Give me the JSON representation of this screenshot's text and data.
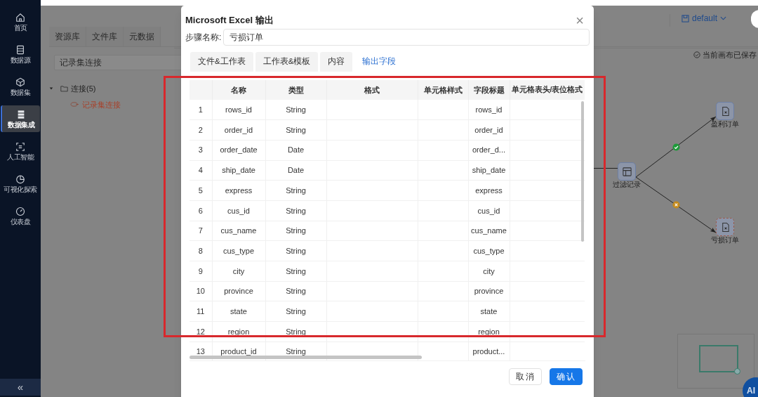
{
  "sidebar": {
    "items": [
      {
        "label": "首页",
        "selected": false
      },
      {
        "label": "数据源",
        "selected": false
      },
      {
        "label": "数据集",
        "selected": false
      },
      {
        "label": "数据集成",
        "selected": true
      },
      {
        "label": "人工智能",
        "selected": false
      },
      {
        "label": "可视化探索",
        "selected": false
      },
      {
        "label": "仪表盘",
        "selected": false
      }
    ],
    "collapse": "«"
  },
  "left_panel": {
    "tabs": [
      {
        "label": "资源库"
      },
      {
        "label": "文件库"
      },
      {
        "label": "元数据"
      }
    ],
    "search": {
      "value": "记录集连接"
    },
    "tree": [
      {
        "label": "连接(5)",
        "expanded": true,
        "children": [
          {
            "label": "记录集连接",
            "highlighted": true
          }
        ]
      }
    ]
  },
  "top_bar": {
    "workspace": "default",
    "save_status": "当前画布已保存"
  },
  "canvas": {
    "nodes": [
      {
        "label": "过滤记录",
        "kind": "filter",
        "selected": false
      },
      {
        "label": "盈利订单",
        "kind": "excel",
        "selected": false
      },
      {
        "label": "亏损订单",
        "kind": "excel",
        "selected": true
      }
    ],
    "edges": [
      {
        "kind": "success"
      },
      {
        "kind": "failure"
      }
    ],
    "ai_button": "AI"
  },
  "dialog": {
    "title": "Microsoft Excel 输出",
    "close": "×",
    "step_name": {
      "label": "步骤名称:",
      "value": "亏损订单"
    },
    "tabs": [
      {
        "label": "文件&工作表",
        "selected": false
      },
      {
        "label": "工作表&模板",
        "selected": false
      },
      {
        "label": "内容",
        "selected": false
      },
      {
        "label": "输出字段",
        "selected": true
      }
    ],
    "table": {
      "columns": [
        "名称",
        "类型",
        "格式",
        "单元格样式",
        "字段标题",
        "单元格表头/表位格式"
      ],
      "rows": [
        {
          "index": "1",
          "name": "rows_id",
          "type": "String",
          "title": "rows_id"
        },
        {
          "index": "2",
          "name": "order_id",
          "type": "String",
          "title": "order_id"
        },
        {
          "index": "3",
          "name": "order_date",
          "type": "Date",
          "title": "order_d..."
        },
        {
          "index": "4",
          "name": "ship_date",
          "type": "Date",
          "title": "ship_date"
        },
        {
          "index": "5",
          "name": "express",
          "type": "String",
          "title": "express"
        },
        {
          "index": "6",
          "name": "cus_id",
          "type": "String",
          "title": "cus_id"
        },
        {
          "index": "7",
          "name": "cus_name",
          "type": "String",
          "title": "cus_name"
        },
        {
          "index": "8",
          "name": "cus_type",
          "type": "String",
          "title": "cus_type"
        },
        {
          "index": "9",
          "name": "city",
          "type": "String",
          "title": "city"
        },
        {
          "index": "10",
          "name": "province",
          "type": "String",
          "title": "province"
        },
        {
          "index": "11",
          "name": "state",
          "type": "String",
          "title": "state"
        },
        {
          "index": "12",
          "name": "region",
          "type": "String",
          "title": "region"
        },
        {
          "index": "13",
          "name": "product_id",
          "type": "String",
          "title": "product..."
        }
      ]
    },
    "buttons": [
      {
        "label": "取消",
        "kind": "secondary"
      },
      {
        "label": "确认",
        "kind": "primary"
      }
    ]
  },
  "annotation": {
    "kind": "highlight-frame"
  }
}
